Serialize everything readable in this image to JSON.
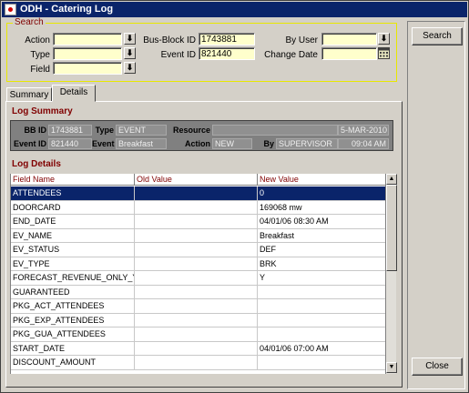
{
  "window": {
    "title": "ODH - Catering Log"
  },
  "search": {
    "legend": "Search",
    "action_label": "Action",
    "action_value": "",
    "type_label": "Type",
    "type_value": "",
    "field_label": "Field",
    "field_value": "",
    "busblock_label": "Bus-Block ID",
    "busblock_value": "1743881",
    "eventid_label": "Event ID",
    "eventid_value": "821440",
    "byuser_label": "By User",
    "byuser_value": "",
    "changedate_label": "Change Date",
    "changedate_value": "",
    "lov_glyph": "⬇"
  },
  "buttons": {
    "search": "Search",
    "close": "Close"
  },
  "tabs": [
    {
      "label": "Summary"
    },
    {
      "label": "Details"
    }
  ],
  "log_summary": {
    "title": "Log Summary",
    "bbid_label": "BB ID",
    "bbid_value": "1743881",
    "type_label": "Type",
    "type_value": "EVENT",
    "resource_label": "Resource",
    "resource_value": "",
    "date_value": "5-MAR-2010",
    "eventid_label": "Event ID",
    "eventid_value": "821440",
    "event_label": "Event",
    "event_value": "Breakfast",
    "action_label": "Action",
    "action_value": "NEW",
    "by_label": "By",
    "by_value": "SUPERVISOR",
    "time_value": "09:04 AM"
  },
  "log_details": {
    "title": "Log Details",
    "columns": [
      "Field Name",
      "Old Value",
      "New Value"
    ],
    "rows": [
      {
        "field": "ATTENDEES",
        "old": "",
        "new": "0"
      },
      {
        "field": "DOORCARD",
        "old": "",
        "new": "169068 mw"
      },
      {
        "field": "END_DATE",
        "old": "",
        "new": "04/01/06 08:30 AM"
      },
      {
        "field": "EV_NAME",
        "old": "",
        "new": "Breakfast"
      },
      {
        "field": "EV_STATUS",
        "old": "",
        "new": "DEF"
      },
      {
        "field": "EV_TYPE",
        "old": "",
        "new": "BRK"
      },
      {
        "field": "FORECAST_REVENUE_ONLY_Y",
        "old": "",
        "new": "Y"
      },
      {
        "field": "GUARANTEED",
        "old": "",
        "new": ""
      },
      {
        "field": "PKG_ACT_ATTENDEES",
        "old": "",
        "new": ""
      },
      {
        "field": "PKG_EXP_ATTENDEES",
        "old": "",
        "new": ""
      },
      {
        "field": "PKG_GUA_ATTENDEES",
        "old": "",
        "new": ""
      },
      {
        "field": "START_DATE",
        "old": "",
        "new": "04/01/06 07:00 AM"
      },
      {
        "field": "DISCOUNT_AMOUNT",
        "old": "",
        "new": ""
      }
    ],
    "selected_index": 0
  },
  "icons": {
    "scroll_up": "▲",
    "scroll_down": "▼"
  }
}
